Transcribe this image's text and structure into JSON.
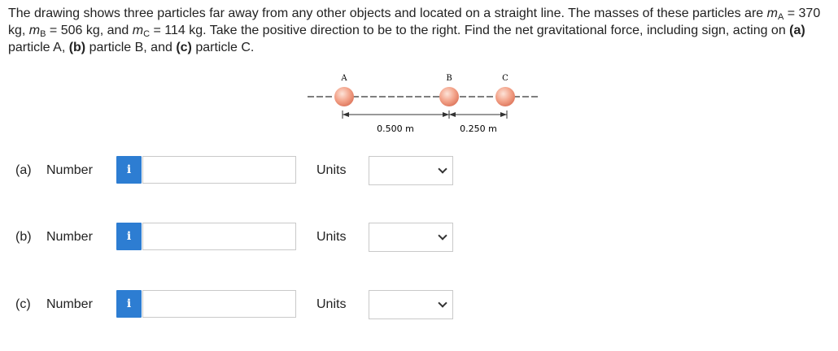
{
  "problem": {
    "intro": "The drawing shows three particles far away from any other objects and located on a straight line. The masses of these particles are ",
    "mass_a_symbol": "m",
    "mass_a_sub": "A",
    "mass_a_value": " = 370 kg, ",
    "mass_b_symbol": "m",
    "mass_b_sub": "B",
    "mass_b_value": " = 506 kg, and ",
    "mass_c_symbol": "m",
    "mass_c_sub": "C",
    "mass_c_value": " = 114 kg. Take the positive direction to be to the right. Find the net gravitational force, including sign, acting on ",
    "part_a": "(a)",
    "part_a_text": " particle A, ",
    "part_b": "(b)",
    "part_b_text": " particle B, and ",
    "part_c": "(c)",
    "part_c_text": " particle C."
  },
  "figure": {
    "label_a": "A",
    "label_b": "B",
    "label_c": "C",
    "distance_ab": "0.500 m",
    "distance_bc": "0.250 m",
    "particle_color": "#f3a38a"
  },
  "questions": [
    {
      "tag": "(a)",
      "label": "Number",
      "info": "i",
      "value": "",
      "units_label": "Units",
      "units_value": ""
    },
    {
      "tag": "(b)",
      "label": "Number",
      "info": "i",
      "value": "",
      "units_label": "Units",
      "units_value": ""
    },
    {
      "tag": "(c)",
      "label": "Number",
      "info": "i",
      "value": "",
      "units_label": "Units",
      "units_value": ""
    }
  ],
  "colors": {
    "info_button": "#2d7dd2",
    "input_border": "#c9c9c9"
  }
}
